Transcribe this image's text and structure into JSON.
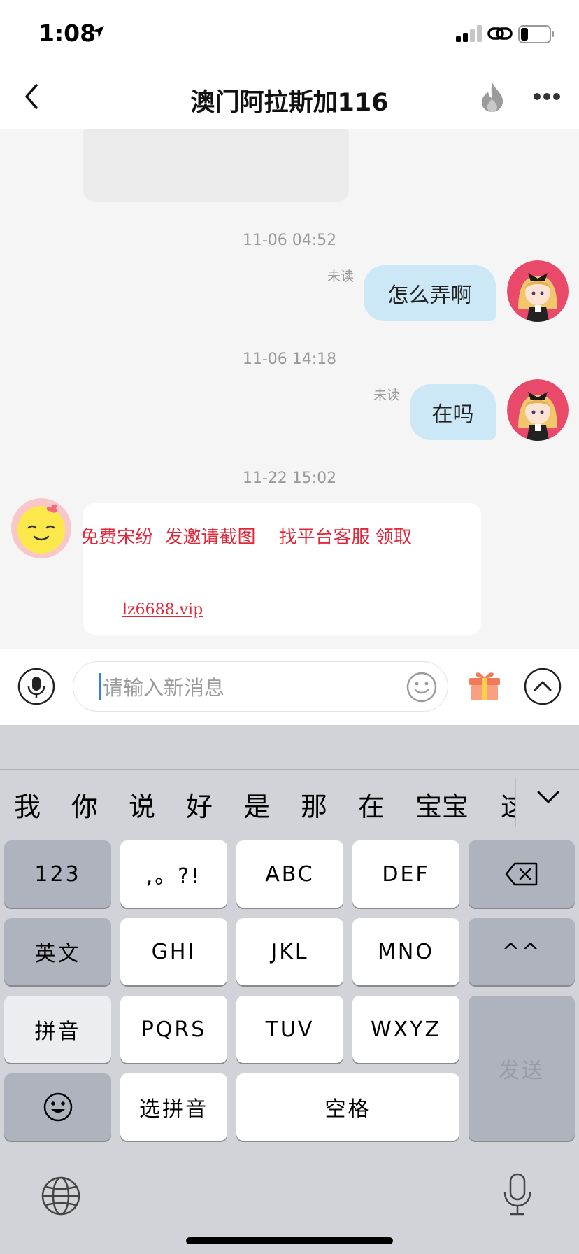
{
  "status_bar": {
    "time": "1:08"
  },
  "nav": {
    "title": "澳门阿拉斯加116"
  },
  "messages": {
    "ts1": "11-06 04:52",
    "ts2": "11-06 14:18",
    "ts3": "11-22 15:02",
    "unread_label": "未读",
    "msg1": "怎么弄啊",
    "msg2": "在吗",
    "promo_text": "免费宋纷  发邀请截图    找平台客服 领取",
    "promo_url": "lz6688.vip"
  },
  "input": {
    "placeholder": "请输入新消息"
  },
  "keyboard": {
    "candidates": [
      "我",
      "你",
      "说",
      "好",
      "是",
      "那",
      "在",
      "宝宝",
      "这"
    ],
    "rows": {
      "r1": [
        "123",
        ",。?!",
        "ABC",
        "DEF"
      ],
      "r2": [
        "英文",
        "GHI",
        "JKL",
        "MNO",
        "^^"
      ],
      "r3": [
        "拼音",
        "PQRS",
        "TUV",
        "WXYZ"
      ],
      "r4": [
        "选拼音",
        "空格"
      ]
    },
    "send": "发送"
  },
  "colors": {
    "bubble_out": "#cce7f6",
    "promo_red": "#e0283a",
    "keyboard_bg": "#d1d3d9"
  },
  "icons": [
    "location-arrow-icon",
    "signal-icon",
    "link-icon",
    "battery-icon",
    "back-icon",
    "fire-icon",
    "more-icon",
    "microphone-icon",
    "emoji-icon",
    "gift-icon",
    "chevron-up-icon",
    "chevron-down-icon",
    "backspace-icon",
    "smiley-icon",
    "globe-icon",
    "dictation-icon"
  ]
}
